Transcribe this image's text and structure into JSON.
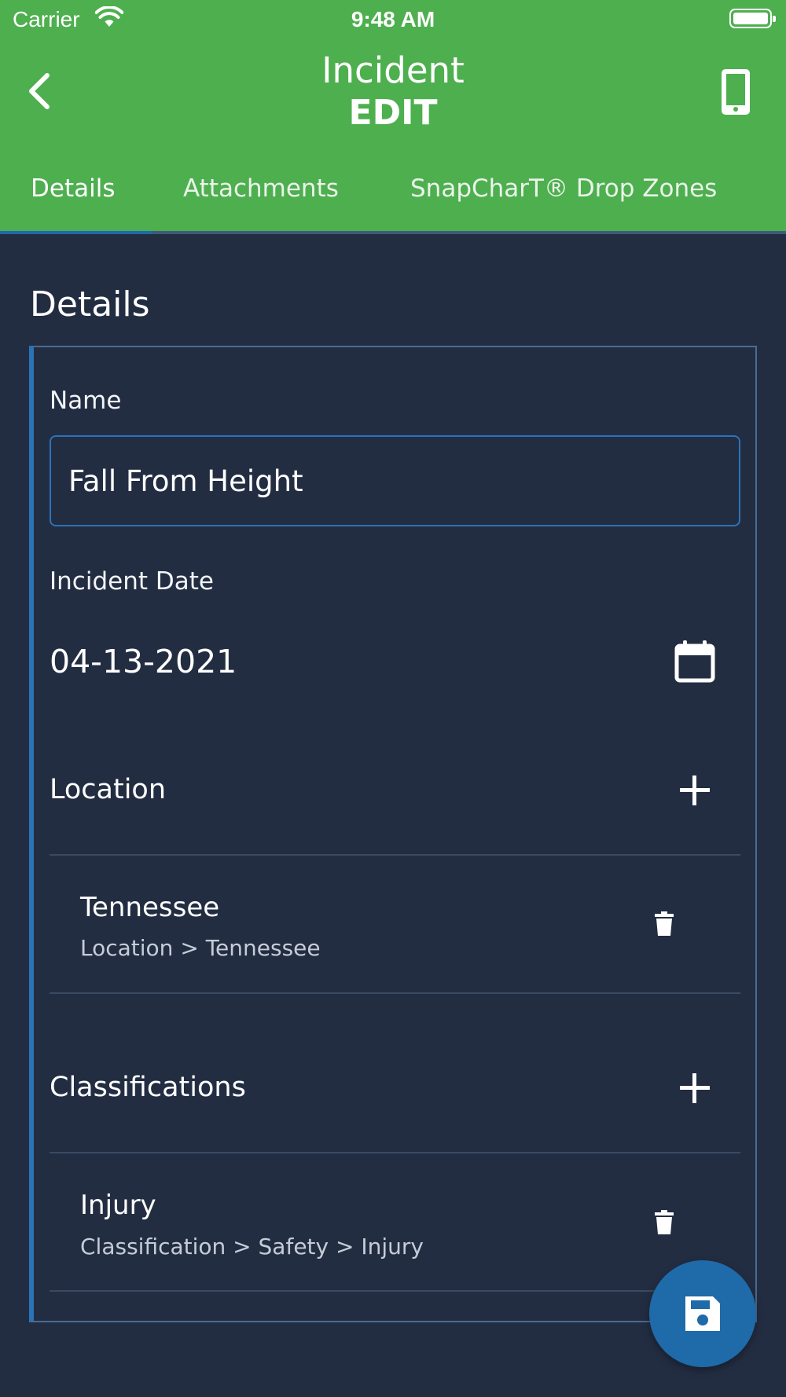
{
  "status_bar": {
    "carrier": "Carrier",
    "time": "9:48 AM"
  },
  "nav": {
    "title": "Incident",
    "subtitle": "EDIT"
  },
  "tabs": [
    {
      "label": "Details",
      "active": true
    },
    {
      "label": "Attachments",
      "active": false
    },
    {
      "label": "SnapCharT® Drop Zones",
      "active": false
    }
  ],
  "section": {
    "title": "Details"
  },
  "form": {
    "name_label": "Name",
    "name_value": "Fall From Height",
    "date_label": "Incident Date",
    "date_value": "04-13-2021",
    "location_label": "Location",
    "locations": [
      {
        "title": "Tennessee",
        "path": "Location > Tennessee"
      }
    ],
    "classifications_label": "Classifications",
    "classifications": [
      {
        "title": "Injury",
        "path": "Classification > Safety > Injury"
      }
    ]
  },
  "icons": {
    "back": "chevron-left-icon",
    "device": "mobile-device-icon",
    "calendar": "calendar-icon",
    "add": "plus-icon",
    "delete": "trash-icon",
    "save": "floppy-disk-icon"
  },
  "colors": {
    "header": "#4eaf4f",
    "background": "#232d42",
    "accent": "#1f6aa8",
    "active_tab_indicator": "#1f6aa8"
  }
}
